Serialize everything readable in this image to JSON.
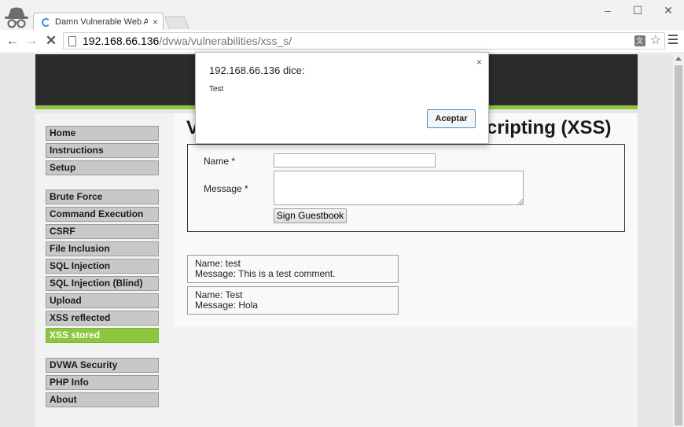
{
  "browser": {
    "tab_title": "Damn Vulnerable Web Ap",
    "tab_close": "×",
    "window_controls": {
      "minimize": "–",
      "maximize": "☐",
      "close": "✕"
    },
    "nav": {
      "back": "←",
      "forward": "→",
      "stop": "✕"
    },
    "url_host": "192.168.66.136",
    "url_path": "/dvwa/vulnerabilities/xss_s/",
    "translate_label": "文",
    "star": "☆"
  },
  "dialog": {
    "title": "192.168.66.136 dice:",
    "message": "Test",
    "close": "×",
    "ok_label": "Aceptar"
  },
  "menu": {
    "group1": [
      "Home",
      "Instructions",
      "Setup"
    ],
    "group2": [
      "Brute Force",
      "Command Execution",
      "CSRF",
      "File Inclusion",
      "SQL Injection",
      "SQL Injection (Blind)",
      "Upload",
      "XSS reflected",
      "XSS stored"
    ],
    "group3": [
      "DVWA Security",
      "PHP Info",
      "About"
    ],
    "selected": "XSS stored"
  },
  "main": {
    "heading": "Vulnerability: Stored Cross Site Scripting (XSS)",
    "form": {
      "name_label": "Name *",
      "name_value": "",
      "message_label": "Message *",
      "message_value": "",
      "submit_label": "Sign Guestbook"
    },
    "comments": [
      {
        "name_line": "Name: test",
        "message_line": "Message: This is a test comment."
      },
      {
        "name_line": "Name: Test",
        "message_line": "Message: Hola"
      }
    ]
  },
  "colors": {
    "accent": "#8dc63f",
    "header": "#2b2b2b",
    "dialog_button_border": "#4a87d6"
  }
}
